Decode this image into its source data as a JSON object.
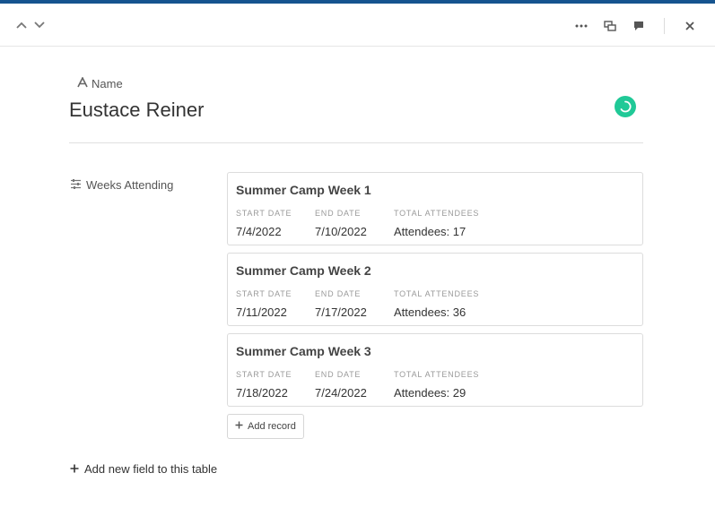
{
  "header": {
    "icons": [
      "chevron-up-icon",
      "chevron-down-icon",
      "more-icon",
      "expand-icon",
      "comment-icon",
      "close-icon"
    ]
  },
  "record": {
    "name_field_label": "Name",
    "name": "Eustace Reiner",
    "status_color": "#20c997"
  },
  "linked_field": {
    "label": "Weeks Attending",
    "columns": [
      "START DATE",
      "END DATE",
      "TOTAL ATTENDEES"
    ],
    "records": [
      {
        "title": "Summer Camp Week 1",
        "start": "7/4/2022",
        "end": "7/10/2022",
        "attendees": "Attendees: 17"
      },
      {
        "title": "Summer Camp Week 2",
        "start": "7/11/2022",
        "end": "7/17/2022",
        "attendees": "Attendees: 36"
      },
      {
        "title": "Summer Camp Week 3",
        "start": "7/18/2022",
        "end": "7/24/2022",
        "attendees": "Attendees: 29"
      }
    ],
    "add_record_label": "Add record"
  },
  "footer": {
    "add_field_label": "Add new field to this table"
  },
  "colors": {
    "top_stripe": "#16548f",
    "accent": "#20c997"
  }
}
